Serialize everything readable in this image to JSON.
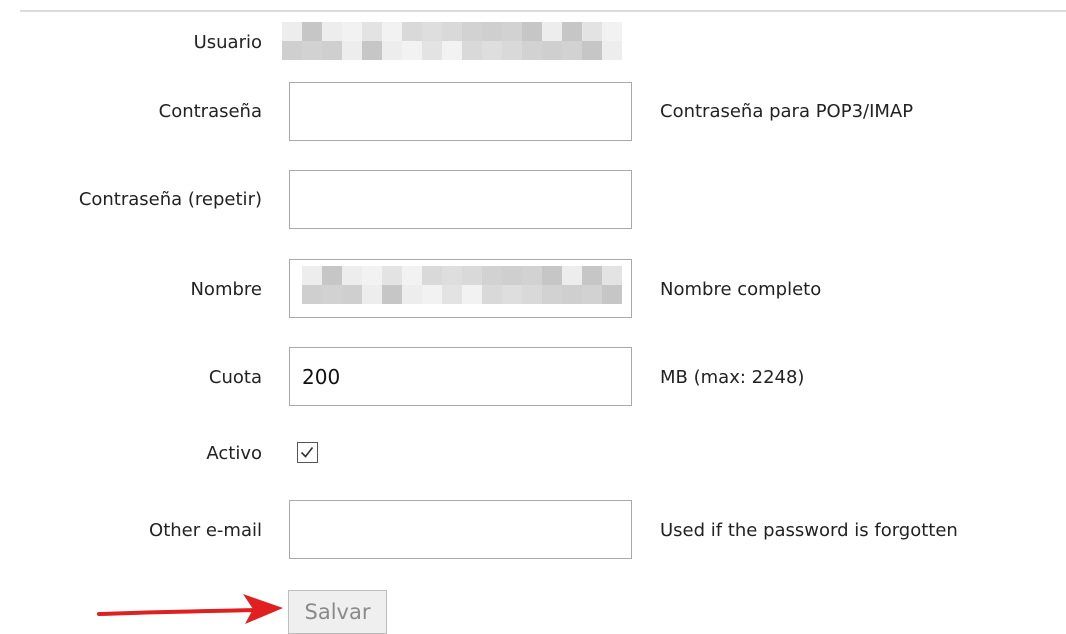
{
  "form": {
    "user": {
      "label": "Usuario"
    },
    "password": {
      "label": "Contraseña",
      "value": "",
      "hint": "Contraseña para POP3/IMAP"
    },
    "password_repeat": {
      "label": "Contraseña (repetir)",
      "value": ""
    },
    "name": {
      "label": "Nombre",
      "hint": "Nombre completo"
    },
    "quota": {
      "label": "Cuota",
      "value": "200",
      "hint": "MB (max: 2248)"
    },
    "active": {
      "label": "Activo",
      "checked": true
    },
    "other_email": {
      "label": "Other e-mail",
      "value": "",
      "hint": "Used if the password is forgotten"
    },
    "save_label": "Salvar"
  },
  "colors": {
    "text": "#222222",
    "field_border": "#a9a9a9",
    "button_bg": "#efefef",
    "button_text": "#8a8a8a",
    "annotation_arrow": "#e02020",
    "divider": "#dcdcdc"
  },
  "icons": {
    "checkbox_check": "check-icon",
    "annotation": "red-arrow-annotation"
  }
}
